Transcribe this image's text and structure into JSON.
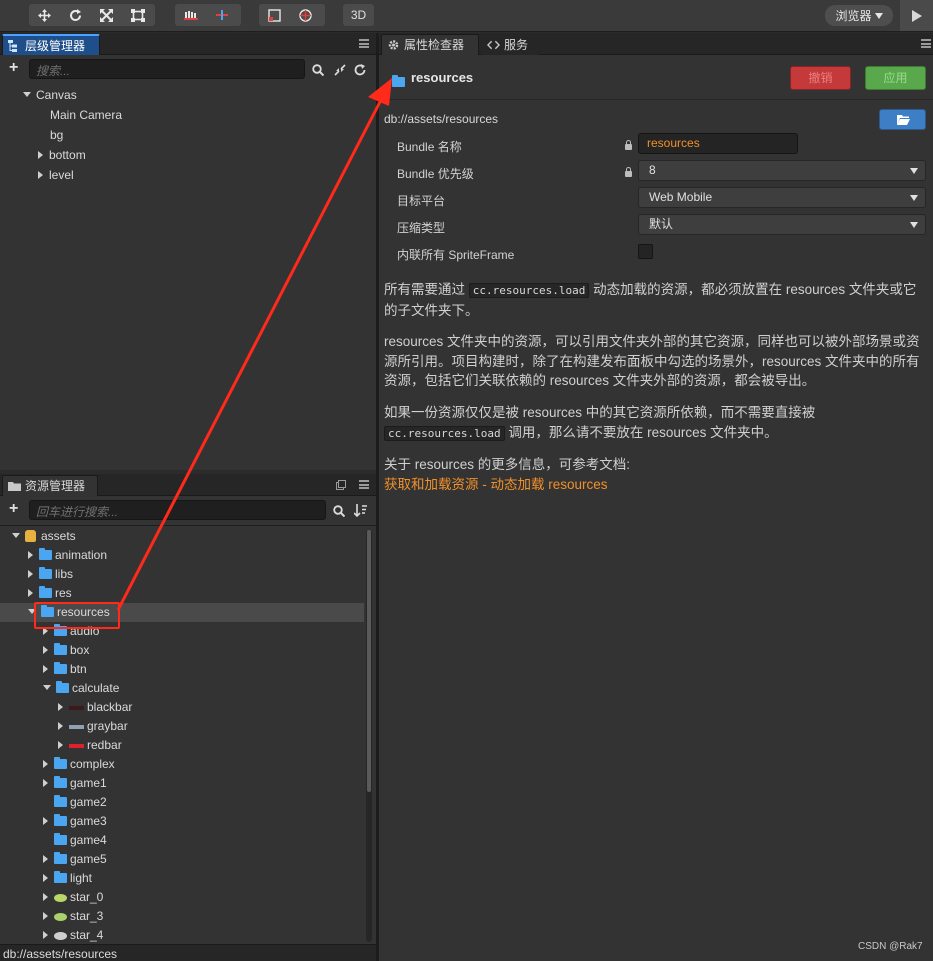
{
  "toolbar": {
    "btn3d": "3D",
    "browser_label": "浏览器",
    "icons": [
      "move-icon",
      "rotate-icon",
      "scale-icon",
      "rect-icon",
      "pivot-icon",
      "local-icon",
      "anchor-icon",
      "global-icon"
    ]
  },
  "hierarchy": {
    "title": "层级管理器",
    "search_placeholder": "搜索...",
    "items": [
      {
        "label": "Canvas",
        "level": 0,
        "expand": "open"
      },
      {
        "label": "Main Camera",
        "level": 1,
        "expand": "none"
      },
      {
        "label": "bg",
        "level": 1,
        "expand": "none"
      },
      {
        "label": "bottom",
        "level": 1,
        "expand": "closed"
      },
      {
        "label": "level",
        "level": 1,
        "expand": "closed"
      }
    ]
  },
  "assets": {
    "title": "资源管理器",
    "search_placeholder": "回车进行搜索...",
    "footer_path": "db://assets/resources",
    "items": [
      {
        "label": "assets",
        "level": 0,
        "expand": "open",
        "icon": "db"
      },
      {
        "label": "animation",
        "level": 1,
        "expand": "closed",
        "icon": "folder"
      },
      {
        "label": "libs",
        "level": 1,
        "expand": "closed",
        "icon": "folder"
      },
      {
        "label": "res",
        "level": 1,
        "expand": "closed",
        "icon": "folder"
      },
      {
        "label": "resources",
        "level": 1,
        "expand": "open",
        "icon": "folder",
        "selected": true
      },
      {
        "label": "audio",
        "level": 2,
        "expand": "closed",
        "icon": "folder"
      },
      {
        "label": "box",
        "level": 2,
        "expand": "closed",
        "icon": "folder"
      },
      {
        "label": "btn",
        "level": 2,
        "expand": "closed",
        "icon": "folder"
      },
      {
        "label": "calculate",
        "level": 2,
        "expand": "open",
        "icon": "folder"
      },
      {
        "label": "blackbar",
        "level": 3,
        "expand": "closed",
        "icon": "bar",
        "color": "#3a1a1a"
      },
      {
        "label": "graybar",
        "level": 3,
        "expand": "closed",
        "icon": "bar",
        "color": "#8fa0b0"
      },
      {
        "label": "redbar",
        "level": 3,
        "expand": "closed",
        "icon": "bar",
        "color": "#e0202a"
      },
      {
        "label": "complex",
        "level": 2,
        "expand": "closed",
        "icon": "folder"
      },
      {
        "label": "game1",
        "level": 2,
        "expand": "closed",
        "icon": "folder"
      },
      {
        "label": "game2",
        "level": 2,
        "expand": "none",
        "icon": "folder"
      },
      {
        "label": "game3",
        "level": 2,
        "expand": "closed",
        "icon": "folder"
      },
      {
        "label": "game4",
        "level": 2,
        "expand": "none",
        "icon": "folder"
      },
      {
        "label": "game5",
        "level": 2,
        "expand": "closed",
        "icon": "folder"
      },
      {
        "label": "light",
        "level": 2,
        "expand": "closed",
        "icon": "folder"
      },
      {
        "label": "star_0",
        "level": 2,
        "expand": "closed",
        "icon": "ellipse",
        "color": "#b8d66a"
      },
      {
        "label": "star_3",
        "level": 2,
        "expand": "closed",
        "icon": "ellipse",
        "color": "#a9d36a"
      },
      {
        "label": "star_4",
        "level": 2,
        "expand": "closed",
        "icon": "ellipse",
        "color": "#cfcfcf"
      }
    ]
  },
  "inspector": {
    "tab_inspector": "属性检查器",
    "tab_service": "服务",
    "asset_name": "resources",
    "revert_label": "撤销",
    "apply_label": "应用",
    "path": "db://assets/resources",
    "props": {
      "bundle_name_label": "Bundle 名称",
      "bundle_name_value": "resources",
      "bundle_priority_label": "Bundle 优先级",
      "bundle_priority_value": "8",
      "target_platform_label": "目标平台",
      "target_platform_value": "Web Mobile",
      "compression_label": "压缩类型",
      "compression_value": "默认",
      "inline_spriteframe_label": "内联所有 SpriteFrame"
    },
    "doc": {
      "p1_a": "所有需要通过",
      "p1_code": "cc.resources.load",
      "p1_b": "动态加载的资源，都必须放置在 resources 文件夹或它的子文件夹下。",
      "p2": "resources 文件夹中的资源，可以引用文件夹外部的其它资源，同样也可以被外部场景或资源所引用。项目构建时，除了在构建发布面板中勾选的场景外，resources 文件夹中的所有资源，包括它们关联依赖的 resources 文件夹外部的资源，都会被导出。",
      "p3_a": "如果一份资源仅仅是被 resources 中的其它资源所依赖，而不需要直接被",
      "p3_code": "cc.resources.load",
      "p3_b": "调用，那么请不要放在 resources 文件夹中。",
      "p4": "关于 resources 的更多信息，可参考文档:",
      "link": "获取和加载资源 - 动态加载 resources"
    }
  },
  "watermark": "CSDN @Rak7",
  "colors": {
    "accent_blue": "#4aa6f0",
    "revert_red": "#c43a3a",
    "apply_green": "#5aa84c",
    "link_orange": "#f0902a",
    "annotation_red": "#ff2a1a"
  }
}
